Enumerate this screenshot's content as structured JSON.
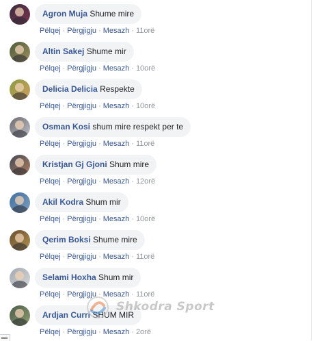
{
  "actions": {
    "like": "Pëlqej",
    "reply": "Përgjigju",
    "message": "Mesazh",
    "separator": "·"
  },
  "comments": [
    {
      "author": "Agron Muja",
      "text": "Shume mire",
      "time": "11orë"
    },
    {
      "author": "Altin Sakej",
      "text": "Shume mir",
      "time": "10orë"
    },
    {
      "author": "Delicia Delicia",
      "text": "Respekte",
      "time": "10orë"
    },
    {
      "author": "Osman Kosi",
      "text": "shum mire respekt per te",
      "time": "11orë"
    },
    {
      "author": "Kristjan Gj Gjoni",
      "text": "Shum mire",
      "time": "12orë"
    },
    {
      "author": "Akil Kodra",
      "text": "Shum mir",
      "time": "10orë"
    },
    {
      "author": "Qerim Boksi",
      "text": "Shume mire",
      "time": "11orë"
    },
    {
      "author": "Selami Hoxha",
      "text": "Shum mir",
      "time": "11orë"
    },
    {
      "author": "Ardjan Curri",
      "text": "SHUM MIR",
      "time": "2orë"
    }
  ],
  "watermark": {
    "text": "Shkodra Sport"
  },
  "colors": {
    "link": "#385898",
    "bubble": "#f2f3f5",
    "meta": "#90949c",
    "text": "#1c1e21"
  },
  "avatar_colors": [
    [
      "#3a2c3f",
      "#7a3550"
    ],
    [
      "#4a5a3a",
      "#a09060"
    ],
    [
      "#8a9a40",
      "#d0a060"
    ],
    [
      "#6a6a70",
      "#c0c0c8"
    ],
    [
      "#404858",
      "#b08060"
    ],
    [
      "#3f6f9f",
      "#80a0c0"
    ],
    [
      "#6a5030",
      "#b09050"
    ],
    [
      "#a0a8b0",
      "#d8d8d8"
    ],
    [
      "#4a5a4a",
      "#90a070"
    ]
  ]
}
